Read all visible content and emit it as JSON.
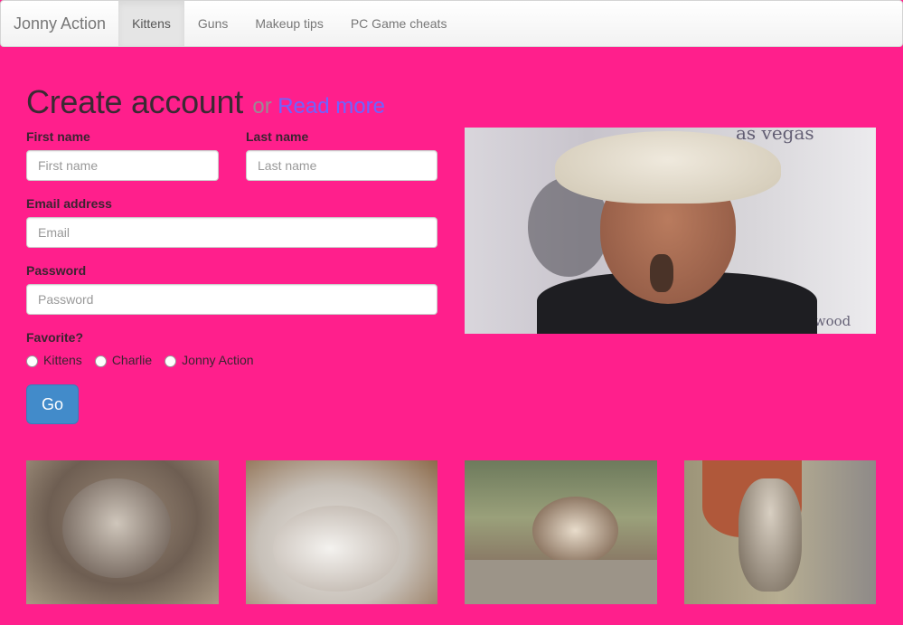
{
  "navbar": {
    "brand": "Jonny Action",
    "items": [
      {
        "label": "Kittens",
        "active": true
      },
      {
        "label": "Guns",
        "active": false
      },
      {
        "label": "Makeup tips",
        "active": false
      },
      {
        "label": "PC Game cheats",
        "active": false
      }
    ]
  },
  "form": {
    "title": "Create account",
    "or_text": "or",
    "read_more": "Read more",
    "first_name": {
      "label": "First name",
      "placeholder": "First name"
    },
    "last_name": {
      "label": "Last name",
      "placeholder": "Last name"
    },
    "email": {
      "label": "Email address",
      "placeholder": "Email"
    },
    "password": {
      "label": "Password",
      "placeholder": "Password"
    },
    "favorite": {
      "label": "Favorite?",
      "options": [
        "Kittens",
        "Charlie",
        "Jonny Action"
      ]
    },
    "submit_label": "Go"
  },
  "images": {
    "feature": {
      "icon": "charlie-photo",
      "caption_fragments": [
        "as vegas",
        "hollywood"
      ]
    },
    "kittens": [
      "kitten-photo-1",
      "kitten-photo-2",
      "kitten-photo-3",
      "kitten-photo-4"
    ]
  },
  "colors": {
    "background": "#ff1f8c",
    "navbar": "#f8f8f8",
    "link": "#6f63ff",
    "button": "#428bca"
  }
}
